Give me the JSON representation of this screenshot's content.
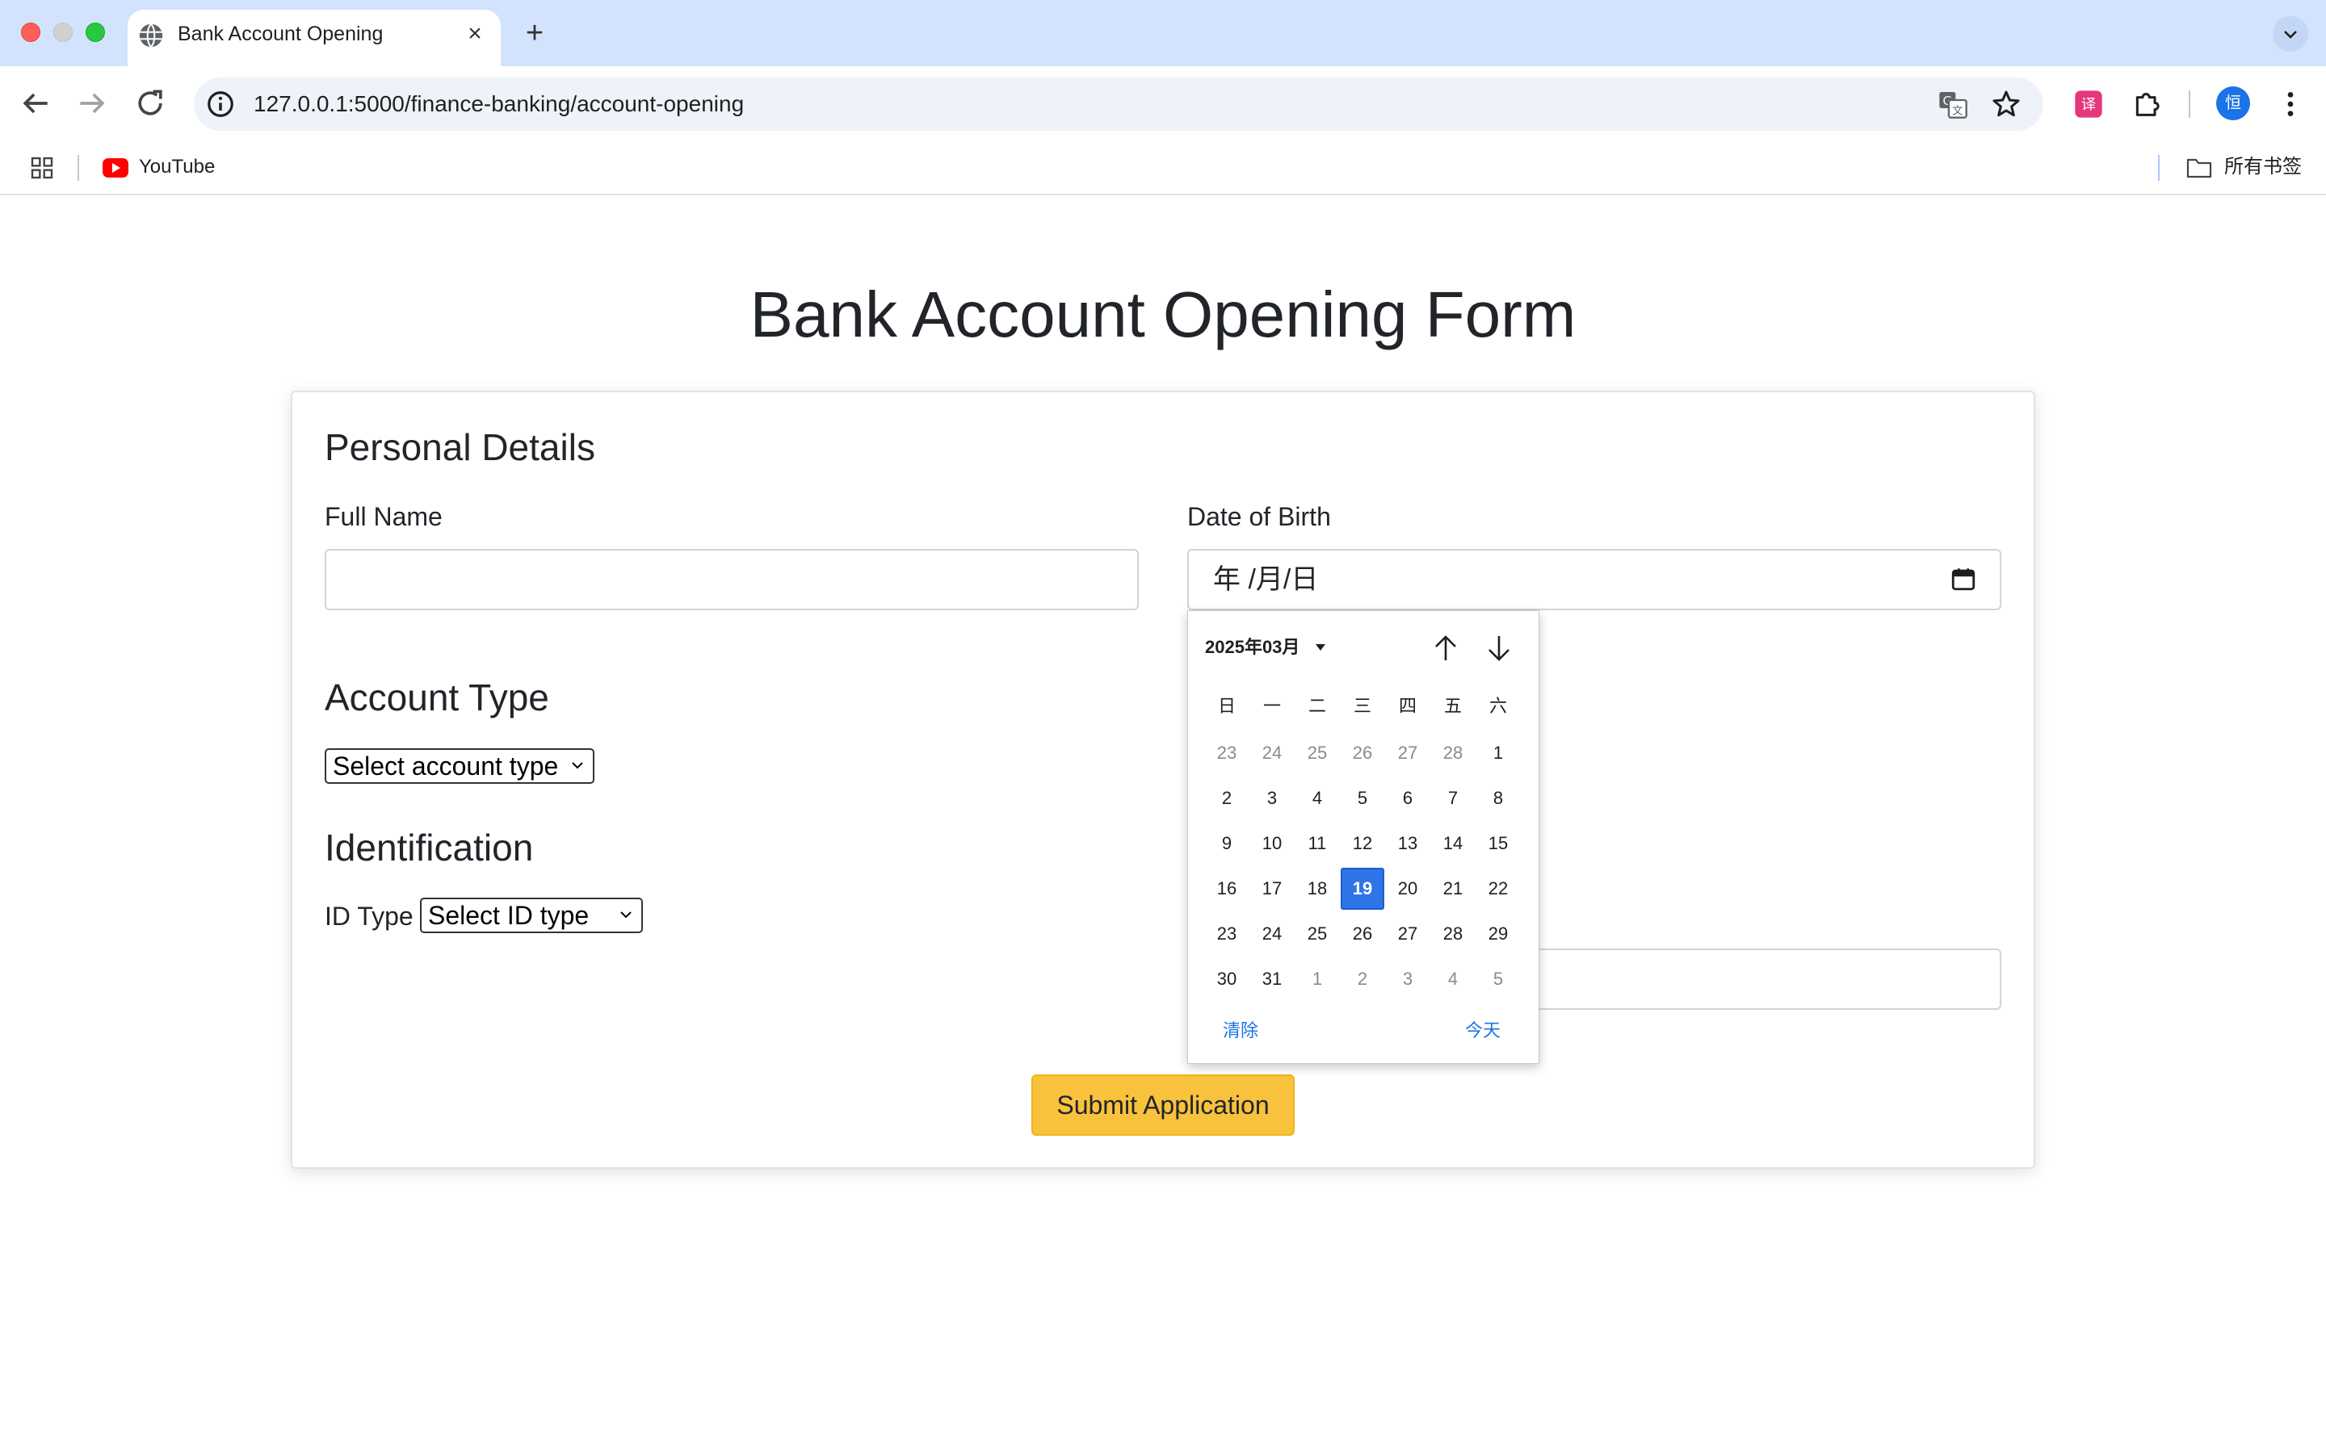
{
  "browser": {
    "tab_title": "Bank Account Opening",
    "url": "127.0.0.1:5000/finance-banking/account-opening",
    "bookmark_youtube": "YouTube",
    "all_bookmarks": "所有书签",
    "avatar_text": "恒"
  },
  "page": {
    "title": "Bank Account Opening Form"
  },
  "form": {
    "personal_heading": "Personal Details",
    "full_name_label": "Full Name",
    "full_name_value": "",
    "dob_label": "Date of Birth",
    "dob_placeholder": "年 /月/日",
    "account_heading": "Account Type",
    "account_select": "Select account type",
    "identification_heading": "Identification",
    "id_type_label": "ID Type",
    "id_select": "Select ID type",
    "submit_label": "Submit Application"
  },
  "datepicker": {
    "month_label": "2025年03月",
    "weekdays": [
      "日",
      "一",
      "二",
      "三",
      "四",
      "五",
      "六"
    ],
    "weeks": [
      [
        "23",
        "24",
        "25",
        "26",
        "27",
        "28",
        "1"
      ],
      [
        "2",
        "3",
        "4",
        "5",
        "6",
        "7",
        "8"
      ],
      [
        "9",
        "10",
        "11",
        "12",
        "13",
        "14",
        "15"
      ],
      [
        "16",
        "17",
        "18",
        "19",
        "20",
        "21",
        "22"
      ],
      [
        "23",
        "24",
        "25",
        "26",
        "27",
        "28",
        "29"
      ],
      [
        "30",
        "31",
        "1",
        "2",
        "3",
        "4",
        "5"
      ]
    ],
    "selected_day": "19",
    "clear_label": "清除",
    "today_label": "今天"
  },
  "colors": {
    "accent": "#f9c23c",
    "selected_day": "#2f74e8",
    "link": "#1a73e8",
    "chrome_tabstrip": "#d3e3fd"
  }
}
